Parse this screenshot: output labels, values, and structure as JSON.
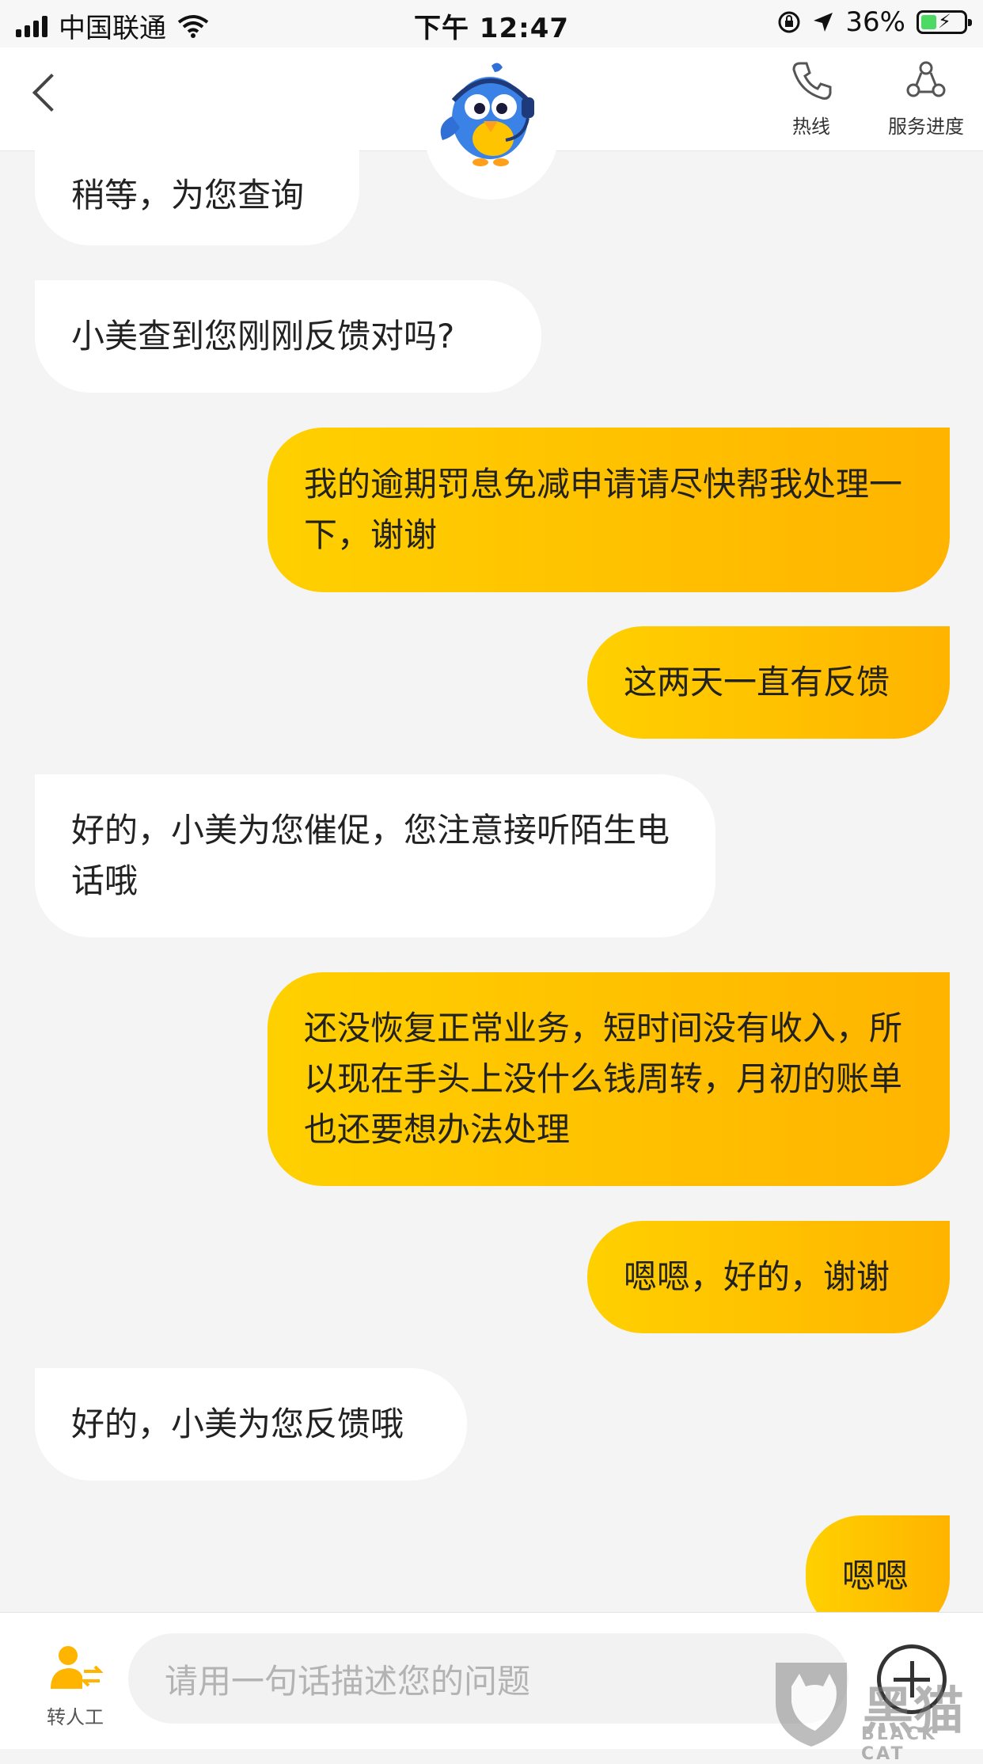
{
  "status_bar": {
    "carrier": "中国联通",
    "time": "下午 12:47",
    "battery_percent": "36%",
    "battery_level": 0.36
  },
  "header": {
    "hotline_label": "热线",
    "service_progress_label": "服务进度"
  },
  "messages": [
    {
      "side": "left",
      "text": "稍等，为您查询"
    },
    {
      "side": "left",
      "text": "小美查到您刚刚反馈对吗?"
    },
    {
      "side": "right",
      "text": "我的逾期罚息免减申请请尽快帮我处理一下，谢谢"
    },
    {
      "side": "right",
      "text": "这两天一直有反馈"
    },
    {
      "side": "left",
      "text": "好的，小美为您催促，您注意接听陌生电话哦"
    },
    {
      "side": "right",
      "text": "还没恢复正常业务，短时间没有收入，所以现在手头上没什么钱周转，月初的账单也还要想办法处理"
    },
    {
      "side": "right",
      "text": "嗯嗯，好的，谢谢"
    },
    {
      "side": "left",
      "text": "好的，小美为您反馈哦"
    },
    {
      "side": "right",
      "text": "嗯嗯"
    }
  ],
  "bottom_bar": {
    "transfer_label": "转人工",
    "input_placeholder": "请用一句话描述您的问题"
  },
  "watermark": {
    "text": "黑猫",
    "sub": "BLACK CAT"
  }
}
